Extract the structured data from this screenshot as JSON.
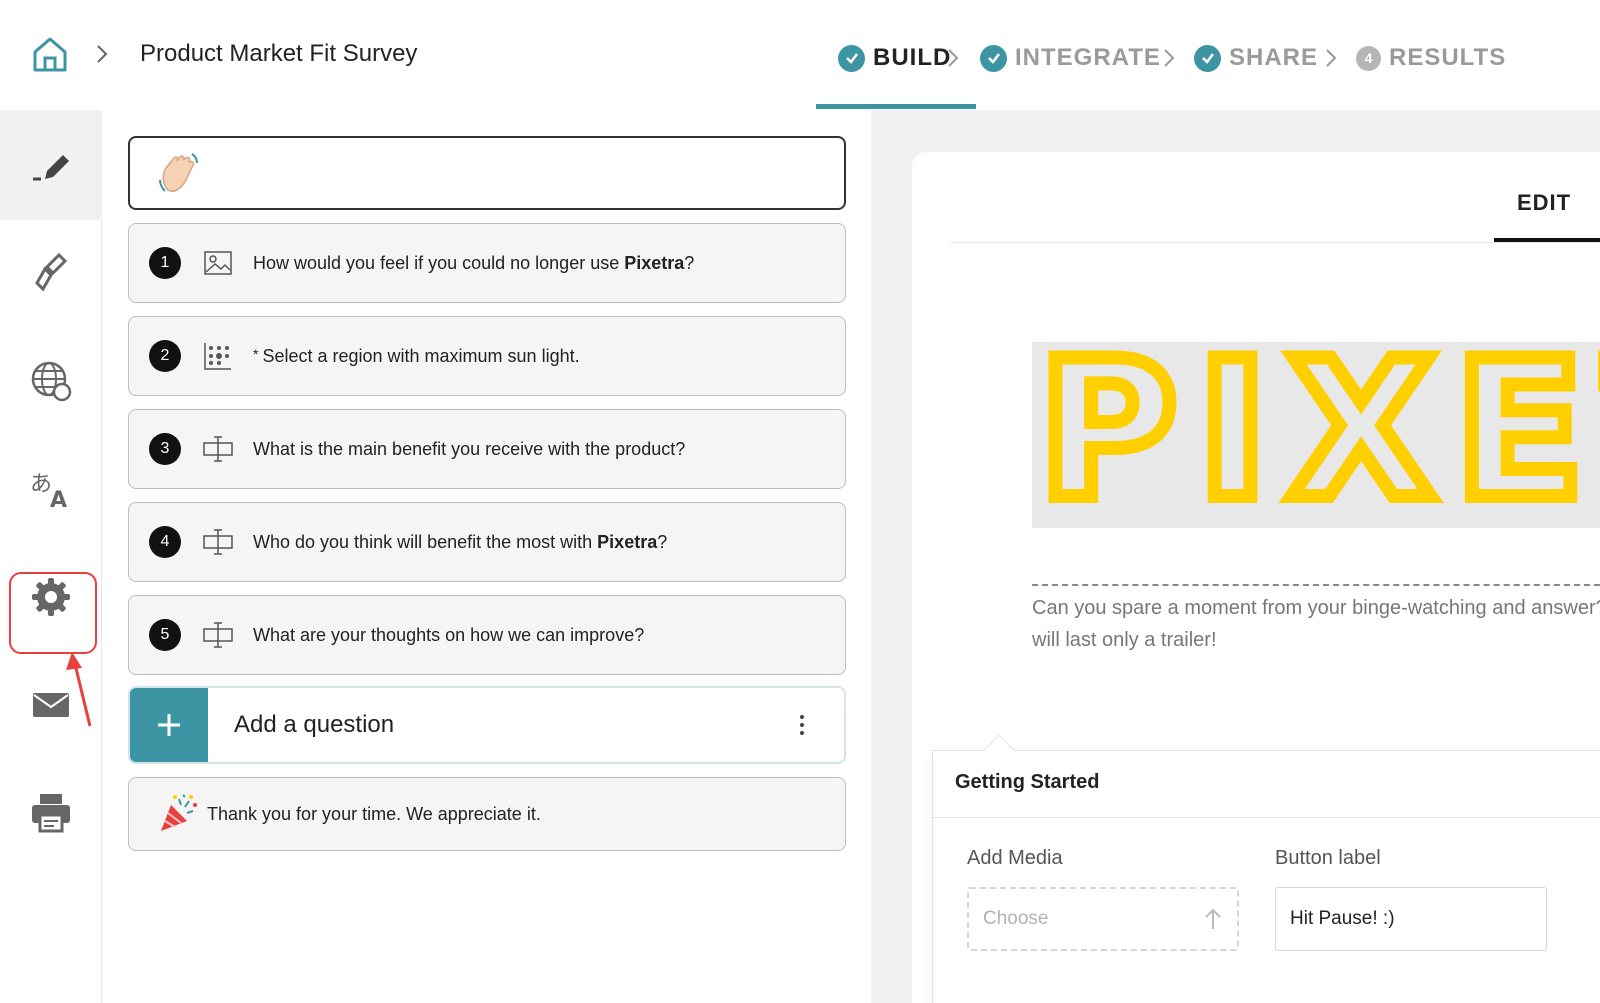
{
  "breadcrumb": {
    "home_icon": "home-icon",
    "title": "Product Market Fit Survey"
  },
  "steps": [
    {
      "label": "BUILD",
      "state": "active",
      "marker": "check"
    },
    {
      "label": "INTEGRATE",
      "state": "done",
      "marker": "check"
    },
    {
      "label": "SHARE",
      "state": "done",
      "marker": "check"
    },
    {
      "label": "RESULTS",
      "state": "pending",
      "marker": "4"
    }
  ],
  "sidebar": {
    "items": [
      {
        "icon": "pencil-icon",
        "active": true
      },
      {
        "icon": "paint-brush-icon"
      },
      {
        "icon": "globe-icon"
      },
      {
        "icon": "translate-icon"
      },
      {
        "icon": "gear-icon",
        "highlighted": true
      },
      {
        "icon": "envelope-icon"
      },
      {
        "icon": "printer-icon"
      }
    ]
  },
  "questions": {
    "welcome_icon": "waving-hand-icon",
    "items": [
      {
        "num": "1",
        "icon": "image-icon",
        "prefix": "How would you feel if you could no longer use ",
        "bold": "Pixetra",
        "suffix": "?"
      },
      {
        "num": "2",
        "icon": "dot-grid-icon",
        "required_mark": "*",
        "prefix": "Select a region with maximum sun light.",
        "bold": "",
        "suffix": ""
      },
      {
        "num": "3",
        "icon": "text-input-icon",
        "prefix": "What is the main benefit you receive with the product?",
        "bold": "",
        "suffix": ""
      },
      {
        "num": "4",
        "icon": "text-input-icon",
        "prefix": "Who do you think will benefit the most with ",
        "bold": "Pixetra",
        "suffix": "?"
      },
      {
        "num": "5",
        "icon": "text-input-icon",
        "prefix": "What are your thoughts on how we can improve?",
        "bold": "",
        "suffix": ""
      }
    ],
    "add_label": "Add a question",
    "thank_you_icon": "party-popper-icon",
    "thank_you_text": "Thank you for your time. We appreciate it."
  },
  "editor": {
    "tab_label": "EDIT",
    "logo_text": "PIXET",
    "intro_text": "Can you spare a moment from your binge-watching and answer? We promise it will last only a trailer!",
    "section_title": "Getting Started",
    "add_media_label": "Add Media",
    "choose_placeholder": "Choose",
    "button_label_label": "Button label",
    "button_label_value": "Hit Pause! :)"
  },
  "colors": {
    "accent": "#3d95a3",
    "highlight": "#e8403c",
    "logo_yellow": "#ffcf00"
  }
}
